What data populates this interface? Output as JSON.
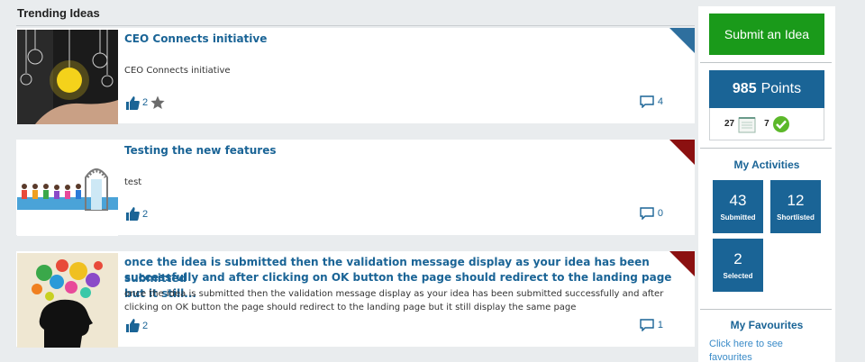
{
  "section_title": "Trending Ideas",
  "colors": {
    "accent_blue": "#1a6496",
    "corner_blue": "#2e6f9e",
    "corner_red": "#8b1010",
    "submit_green": "#1a9a1a",
    "check_green": "#5cb82a"
  },
  "ideas": [
    {
      "title": "CEO Connects initiative",
      "title_line2": "",
      "description": "CEO Connects initiative",
      "description_line2": "",
      "likes": "2",
      "comments": "4",
      "corner_color": "blue",
      "thumb": "lightbulb-hand-image"
    },
    {
      "title": "Testing the new features",
      "title_line2": "",
      "description": "test",
      "description_line2": "",
      "likes": "2",
      "comments": "0",
      "corner_color": "red",
      "thumb": "people-queue-door-image"
    },
    {
      "title": "once the idea is submitted then the validation message display as your idea has been submitted",
      "title_line2": "successfully and after clicking on OK button the page should redirect to the landing page but it still...",
      "description": "once the idea is submitted then the validation message display as your idea has been submitted successfully and after",
      "description_line2": "clicking on OK button the page should redirect to the landing page but it still display the same page",
      "likes": "2",
      "comments": "1",
      "corner_color": "red",
      "thumb": "colorful-head-silhouette-image"
    }
  ],
  "sidebar": {
    "submit_label": "Submit an Idea",
    "points_value": "985",
    "points_label": "Points",
    "stat_notes": "27",
    "stat_checks": "7",
    "activities_title": "My Activities",
    "activities": [
      {
        "count": "43",
        "label": "Submitted"
      },
      {
        "count": "12",
        "label": "Shortlisted"
      },
      {
        "count": "2",
        "label": "Selected"
      }
    ],
    "favourites_title": "My Favourites",
    "favourites_link": "Click here to see favourites"
  }
}
